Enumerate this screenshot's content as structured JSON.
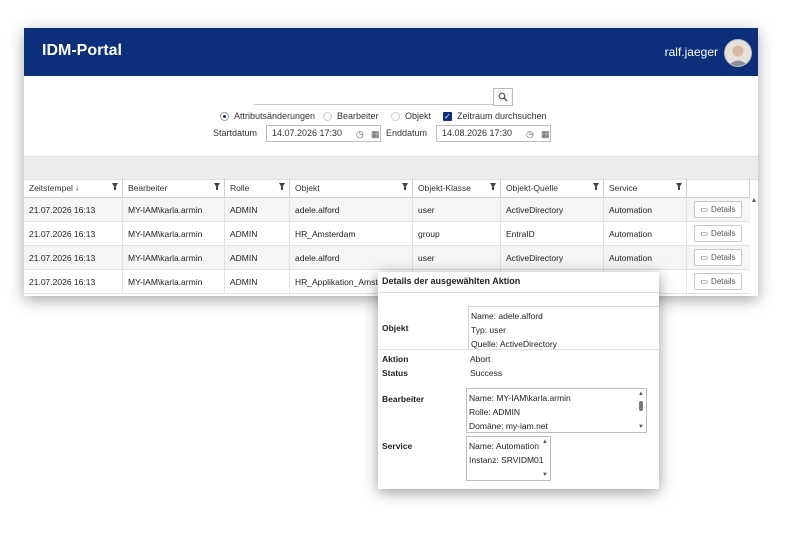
{
  "app": {
    "title": "IDM-Portal",
    "user": "ralf.jaeger"
  },
  "filters": {
    "search_placeholder": "",
    "radios": [
      {
        "label": "Attributsänderungen",
        "selected": true
      },
      {
        "label": "Bearbeiter",
        "selected": false
      },
      {
        "label": "Objekt",
        "selected": false
      }
    ],
    "checkbox": {
      "label": "Zeitraum durchsuchen",
      "checked": true
    },
    "start_label": "Startdatum",
    "start_value": "14.07.2026 17:30",
    "end_label": "Enddatum",
    "end_value": "14.08.2026 17:30"
  },
  "table": {
    "columns": [
      "Zeitstempel",
      "Bearbeiter",
      "Rolle",
      "Objekt",
      "Objekt-Klasse",
      "Objekt-Quelle",
      "Service",
      ""
    ],
    "details_label": "Details",
    "rows": [
      [
        "21.07.2026 16:13",
        "MY-IAM\\karla.armin",
        "ADMIN",
        "adele.alford",
        "user",
        "ActiveDirectory",
        "Automation"
      ],
      [
        "21.07.2026 16:13",
        "MY-IAM\\karla.armin",
        "ADMIN",
        "HR_Amsterdam",
        "group",
        "EntraID",
        "Automation"
      ],
      [
        "21.07.2026 16:13",
        "MY-IAM\\karla.armin",
        "ADMIN",
        "adele.alford",
        "user",
        "ActiveDirectory",
        "Automation"
      ],
      [
        "21.07.2026 16:13",
        "MY-IAM\\karla.armin",
        "ADMIN",
        "HR_Applikation_Amster",
        "",
        "",
        ""
      ]
    ]
  },
  "details": {
    "title": "Details der ausgewählten Aktion",
    "objekt_label": "Objekt",
    "objekt_lines": [
      "Name: adele.alford",
      "Typ: user",
      "Quelle: ActiveDirectory"
    ],
    "aktion_label": "Aktion",
    "aktion_value": "Abort",
    "status_label": "Status",
    "status_value": "Success",
    "bearbeiter_label": "Bearbeiter",
    "bearbeiter_lines": [
      "Name: MY-IAM\\karla.armin",
      "Rolle: ADMIN",
      "Domäne: my-iam.net"
    ],
    "service_label": "Service",
    "service_lines": [
      "Name: Automation",
      "Instanz: SRVIDM01"
    ]
  },
  "colors": {
    "header": "#0b2f7a",
    "accent": "#0b2f7a"
  }
}
